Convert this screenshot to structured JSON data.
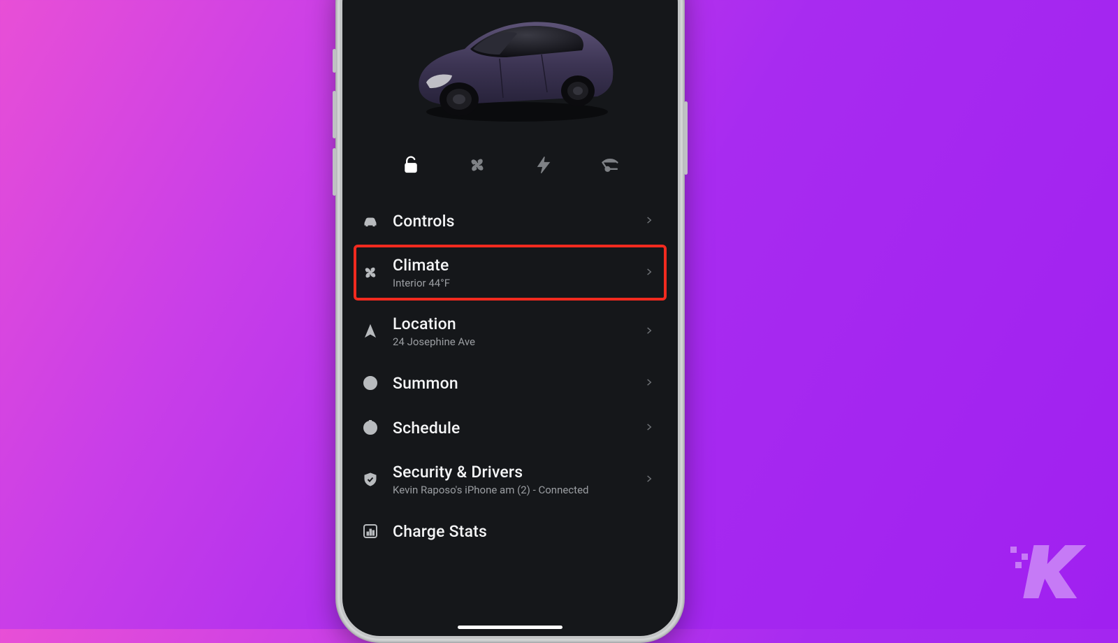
{
  "quick_actions": {
    "lock": "unlock-icon",
    "fan": "fan-icon",
    "bolt": "bolt-icon",
    "port": "charge-port-icon"
  },
  "menu": {
    "controls": {
      "title": "Controls"
    },
    "climate": {
      "title": "Climate",
      "sub": "Interior 44°F"
    },
    "location": {
      "title": "Location",
      "sub": "24 Josephine Ave"
    },
    "summon": {
      "title": "Summon"
    },
    "schedule": {
      "title": "Schedule"
    },
    "security": {
      "title": "Security & Drivers",
      "sub": "Kevin Raposo's iPhone am (2) - Connected"
    },
    "charge_stats": {
      "title": "Charge Stats"
    }
  },
  "highlighted_item": "climate",
  "watermark": "K"
}
